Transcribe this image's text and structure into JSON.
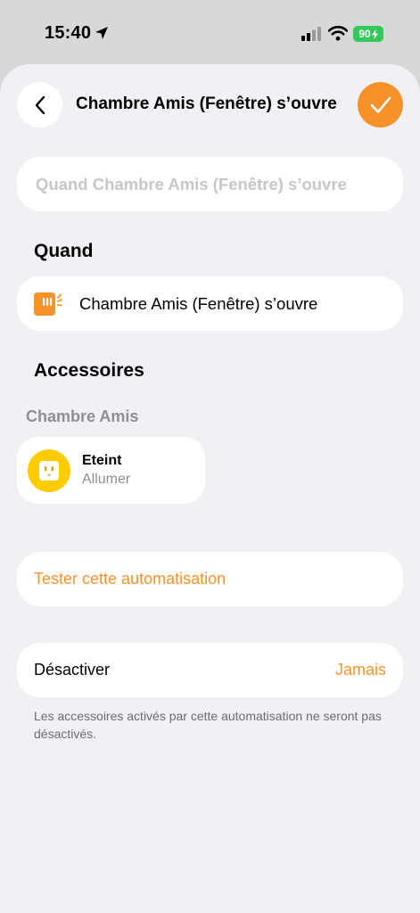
{
  "status_bar": {
    "time": "15:40",
    "battery": "90"
  },
  "header": {
    "title": "Chambre Amis (Fenêtre) s’ouvre"
  },
  "name_field": {
    "placeholder": "Quand Chambre Amis (Fenêtre) s’ouvre"
  },
  "when_section": {
    "title": "Quand",
    "trigger_label": "Chambre Amis (Fenêtre) s’ouvre"
  },
  "accessories_section": {
    "title": "Accessoires",
    "room": "Chambre Amis",
    "accessory_name": "Eteint",
    "accessory_action": "Allumer"
  },
  "test_button": {
    "label": "Tester cette automatisation"
  },
  "disable_row": {
    "label": "Désactiver",
    "value": "Jamais"
  },
  "footnote": "Les accessoires activés par cette automatisation ne seront pas désactivés.",
  "colors": {
    "accent": "#f7922b",
    "outlet": "#ffcc00",
    "battery": "#34c759",
    "background": "#f1f0f5"
  },
  "icons": [
    "location-arrow-icon",
    "cellular-signal-icon",
    "wifi-icon",
    "battery-icon",
    "chevron-left-icon",
    "checkmark-icon",
    "window-sensor-icon",
    "outlet-icon"
  ]
}
